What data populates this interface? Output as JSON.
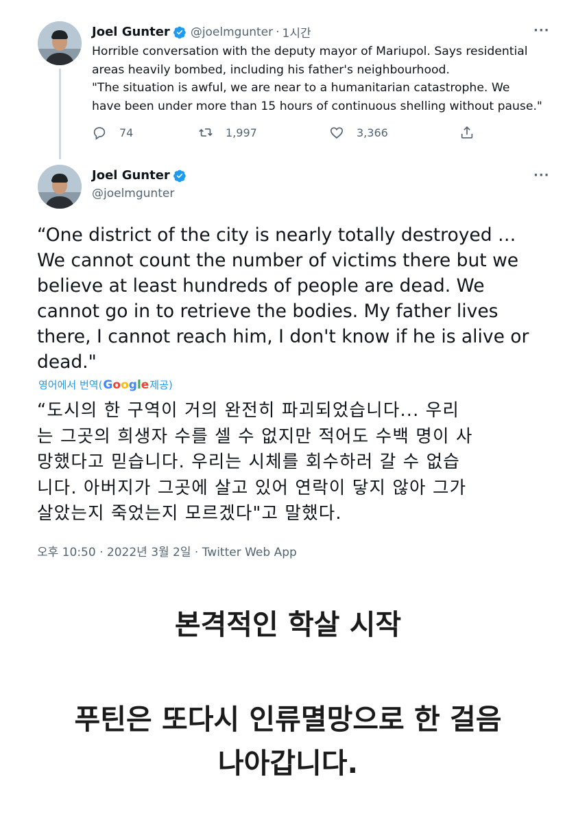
{
  "tweet1": {
    "author_name": "Joel Gunter",
    "handle": "@joelmgunter",
    "separator": "·",
    "time_ago": "1시간",
    "more": "···",
    "lines": [
      "Horrible conversation with the deputy mayor of Mariupol. Says residential",
      "areas heavily bombed, including his father's neighbourhood.",
      "\"The situation is awful, we are near to a humanitarian catastrophe. We",
      "have been under more than 15 hours of continuous shelling without pause.\""
    ],
    "replies": "74",
    "retweets": "1,997",
    "likes": "3,366"
  },
  "tweet2": {
    "author_name": "Joel Gunter",
    "handle": "@joelmgunter",
    "more": "···",
    "lines": [
      "“One district of the city is nearly totally destroyed …",
      "We cannot count the number of victims there but we",
      "believe at least hundreds of people are dead. We",
      "cannot go in to retrieve the bodies. My father lives",
      "there, I cannot reach him, I don't know if he is alive or",
      "dead.\""
    ],
    "translate_prefix": "영어에서 번역(",
    "google": "Google",
    "translate_suffix": " 제공)",
    "translated_lines": [
      "“도시의 한 구역이 거의 완전히 파괴되었습니다... 우리",
      "는 그곳의 희생자 수를 셀 수 없지만 적어도 수백 명이 사",
      "망했다고 믿습니다. 우리는 시체를 회수하러 갈 수 없습",
      "니다. 아버지가 그곳에 살고 있어 연락이 닿지 않아 그가",
      "살았는지 죽었는지 모르겠다\"고 말했다."
    ],
    "timestamp": "오후 10:50 · 2022년 3월 2일 · Twitter Web App"
  },
  "caption": {
    "line1": "본격적인 학살 시작",
    "line2": "푸틴은 또다시 인류멸망으로 한 걸음",
    "line3": "나아갑니다."
  },
  "colors": {
    "verified": "#1d9bf0",
    "secondary_text": "#536471",
    "link": "#1d9bf0"
  },
  "icons": [
    "reply-icon",
    "retweet-icon",
    "like-icon",
    "share-icon",
    "verified-badge-icon",
    "more-icon"
  ]
}
